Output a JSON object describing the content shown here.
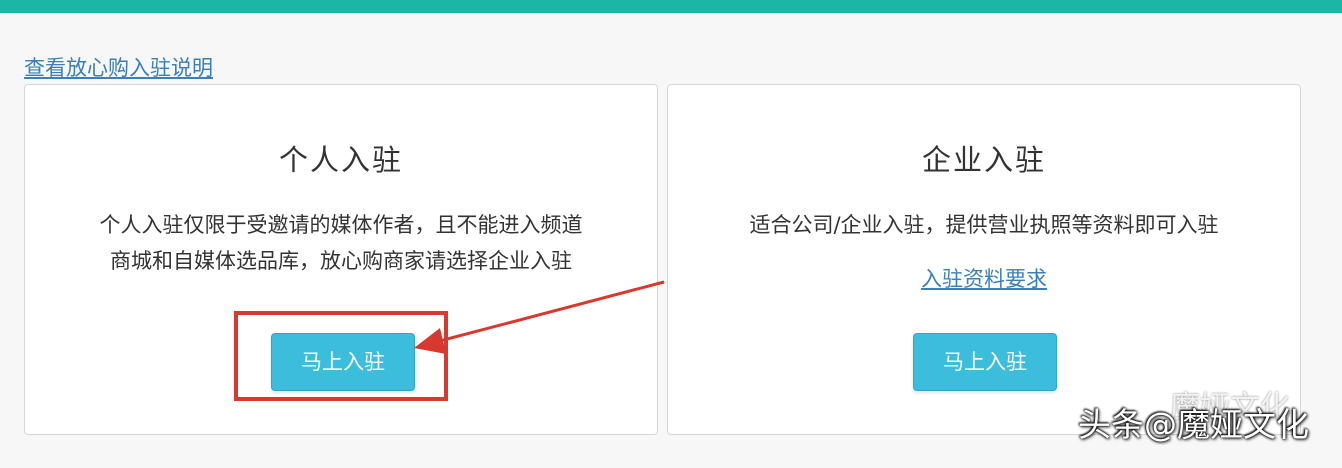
{
  "links": {
    "entry_info": "查看放心购入驻说明",
    "requirements": "入驻资料要求"
  },
  "personal": {
    "title": "个人入驻",
    "desc_line1": "个人入驻仅限于受邀请的媒体作者，且不能进入频道",
    "desc_line2": "商城和自媒体选品库，放心购商家请选择企业入驻",
    "button": "马上入驻"
  },
  "business": {
    "title": "企业入驻",
    "desc": "适合公司/企业入驻，提供营业执照等资料即可入驻",
    "button": "马上入驻"
  },
  "watermark": {
    "text": "头条@魔娅文化",
    "logo_text": "魔娅文化"
  },
  "colors": {
    "accent_bar": "#1bb7a4",
    "button": "#3bbddb",
    "link": "#3a7fb8",
    "annotation": "#d8392f"
  }
}
